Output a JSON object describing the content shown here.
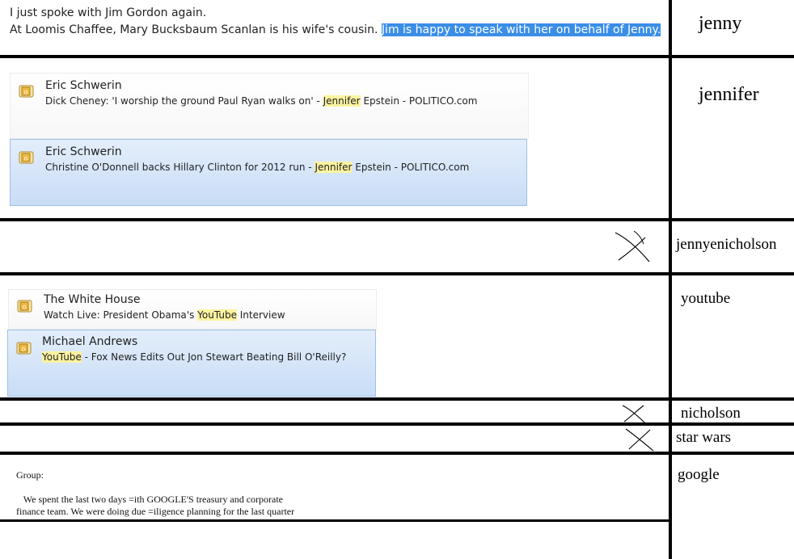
{
  "note": {
    "line1": "I just spoke with Jim Gordon again.",
    "line2_plain": "At Loomis Chaffee, Mary Bucksbaum Scanlan is his wife's cousin.",
    "line2_selected": "Jim is happy to speak with her on behalf of Jenny."
  },
  "keywords": [
    "jenny",
    "jennifer",
    "jennyenicholson",
    "youtube",
    "nicholson",
    "star wars",
    "google"
  ],
  "search_results_jennifer": [
    {
      "sender": "Eric Schwerin",
      "subject_before": "Dick Cheney: 'I worship the ground Paul Ryan walks on' - ",
      "match": "Jennifer",
      "subject_after": " Epstein - POLITICO.com",
      "selected": false
    },
    {
      "sender": "Eric Schwerin",
      "subject_before": "Christine O'Donnell backs Hillary Clinton for 2012 run - ",
      "match": "Jennifer",
      "subject_after": " Epstein - POLITICO.com",
      "selected": true
    }
  ],
  "search_results_youtube": [
    {
      "sender": "The White House",
      "subject_before": "Watch Live: President Obama's ",
      "match": "YouTube",
      "subject_after": " Interview",
      "selected": false
    },
    {
      "sender": "Michael Andrews",
      "subject_before": "",
      "match": "YouTube",
      "subject_after": " - Fox News Edits Out Jon Stewart Beating Bill O'Reilly?",
      "selected": true
    }
  ],
  "memo": {
    "greeting": "Group:",
    "line1": "   We spent the last two days =ith GOOGLE'S treasury and corporate",
    "line2": "finance team. We were doing due =iligence planning for the last quarter"
  },
  "icons": {
    "mail": "outlook-mail-icon",
    "no_result": "x-mark-icon"
  },
  "colors": {
    "selection": "#3a8ee6",
    "highlight": "#fbf3a0",
    "selected_card": "#c9ddf6"
  }
}
